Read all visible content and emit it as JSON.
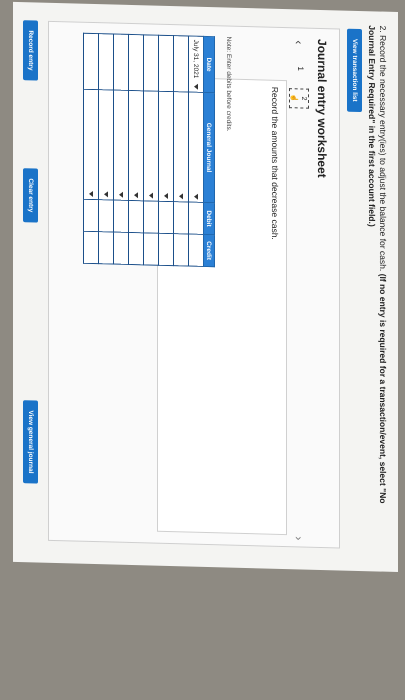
{
  "question": {
    "number": "2.",
    "text": "Record the necessary entry(ies) to adjust the balance for cash.",
    "bold_text": "(If no entry is required for a transaction/event, select \"No Journal Entry Required\" in the first account field.)"
  },
  "buttons": {
    "view_transaction_list": "View transaction list",
    "record_entry": "Record entry",
    "clear_entry": "Clear entry",
    "view_general_journal": "View general journal"
  },
  "worksheet": {
    "title": "Journal entry worksheet",
    "pages": [
      "1",
      "2"
    ],
    "current_page": "2",
    "instruction": "Record the amounts that decrease cash.",
    "note": "Note: Enter debits before credits."
  },
  "journal": {
    "headers": [
      "Date",
      "General Journal",
      "Debit",
      "Credit"
    ],
    "rows": [
      {
        "date": "July 31, 2021",
        "account": "",
        "debit": "",
        "credit": ""
      },
      {
        "date": "",
        "account": "",
        "debit": "",
        "credit": ""
      },
      {
        "date": "",
        "account": "",
        "debit": "",
        "credit": ""
      },
      {
        "date": "",
        "account": "",
        "debit": "",
        "credit": ""
      },
      {
        "date": "",
        "account": "",
        "debit": "",
        "credit": ""
      },
      {
        "date": "",
        "account": "",
        "debit": "",
        "credit": ""
      },
      {
        "date": "",
        "account": "",
        "debit": "",
        "credit": ""
      },
      {
        "date": "",
        "account": "",
        "debit": "",
        "credit": ""
      }
    ]
  }
}
